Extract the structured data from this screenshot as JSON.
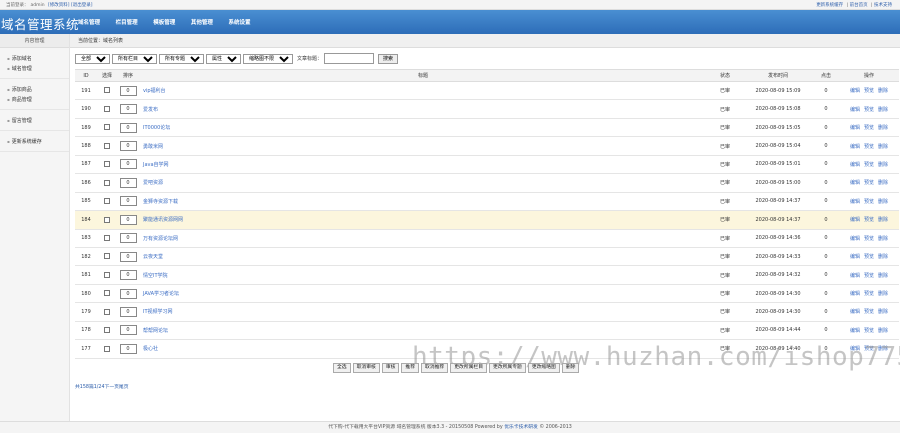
{
  "topbar": {
    "user_prefix": "当前登录：",
    "username": "admin",
    "links_left": [
      "[修改资料]",
      "[退出登录]"
    ],
    "links_right": [
      "更新系统缓存",
      "|",
      "前台首页",
      "|",
      "技术支持"
    ]
  },
  "header": {
    "logo": "域名管理系统",
    "nav": [
      "域名管理",
      "栏目管理",
      "模板管理",
      "其他管理",
      "系统设置"
    ]
  },
  "sidebar": {
    "title": "内容管理",
    "groups": [
      [
        "添加域名",
        "域名管理"
      ],
      [
        "添加商品",
        "商品管理"
      ],
      [
        "留言管理"
      ],
      [
        "更新系统缓存"
      ]
    ]
  },
  "breadcrumb": "当前位置：域名列表",
  "filter": {
    "selects": [
      "全部",
      "所有栏目",
      "所有专题",
      "属性",
      "缩略图不限"
    ],
    "label": "文章标题：",
    "search_button": "搜索"
  },
  "table": {
    "headers": [
      "ID",
      "选择",
      "排序",
      "标题",
      "状态",
      "发布时间",
      "点击",
      "操作"
    ],
    "rows": [
      {
        "id": "191",
        "order": "0",
        "title": "vip福利台",
        "status": "已审",
        "time": "2020-08-09 15:09",
        "clicks": "0"
      },
      {
        "id": "190",
        "order": "0",
        "title": "爱发布",
        "status": "已审",
        "time": "2020-08-09 15:08",
        "clicks": "0"
      },
      {
        "id": "189",
        "order": "0",
        "title": "IT0000论坛",
        "status": "已审",
        "time": "2020-08-09 15:05",
        "clicks": "0"
      },
      {
        "id": "188",
        "order": "0",
        "title": "勇敢米网",
        "status": "已审",
        "time": "2020-08-09 15:04",
        "clicks": "0"
      },
      {
        "id": "187",
        "order": "0",
        "title": "Java自学网",
        "status": "已审",
        "time": "2020-08-09 15:01",
        "clicks": "0"
      },
      {
        "id": "186",
        "order": "0",
        "title": "爱吧资源",
        "status": "已审",
        "time": "2020-08-09 15:00",
        "clicks": "0"
      },
      {
        "id": "185",
        "order": "0",
        "title": "金狮寺资源下载",
        "status": "已审",
        "time": "2020-08-09 14:37",
        "clicks": "0"
      },
      {
        "id": "184",
        "order": "0",
        "title": "聚能通讯资源网网",
        "status": "已审",
        "time": "2020-08-09 14:37",
        "clicks": "0"
      },
      {
        "id": "183",
        "order": "0",
        "title": "万有资源论坛网",
        "status": "已审",
        "time": "2020-08-09 14:36",
        "clicks": "0"
      },
      {
        "id": "182",
        "order": "0",
        "title": "云夜天堂",
        "status": "已审",
        "time": "2020-08-09 14:33",
        "clicks": "0"
      },
      {
        "id": "181",
        "order": "0",
        "title": "情空IT学院",
        "status": "已审",
        "time": "2020-08-09 14:32",
        "clicks": "0"
      },
      {
        "id": "180",
        "order": "0",
        "title": "JAVA学习者论坛",
        "status": "已审",
        "time": "2020-08-09 14:30",
        "clicks": "0"
      },
      {
        "id": "179",
        "order": "0",
        "title": "IT视频学习网",
        "status": "已审",
        "time": "2020-08-09 14:30",
        "clicks": "0"
      },
      {
        "id": "178",
        "order": "0",
        "title": "帮帮网论坛",
        "status": "已审",
        "time": "2020-08-09 14:44",
        "clicks": "0"
      },
      {
        "id": "177",
        "order": "0",
        "title": "极心社",
        "status": "已审",
        "time": "2020-08-09 14:40",
        "clicks": "0"
      }
    ],
    "ops": [
      "编辑",
      "预览",
      "删除"
    ]
  },
  "actions": [
    "全选",
    "取消审核",
    "审核",
    "推荐",
    "取消推荐",
    "更改所属栏目",
    "更改所属专题",
    "更改缩略图",
    "删除"
  ],
  "watermark": "https://www.huzhan.com/ishop7751",
  "pager": "共158篇1/24下一页尾页",
  "footer": {
    "text": "代下购-代下载用大平台VIP资源 域名管理系统 版本3.3 - 20150508 Powered by",
    "link": "优乐卡技术研发",
    "suffix": "© 2006-2013"
  }
}
